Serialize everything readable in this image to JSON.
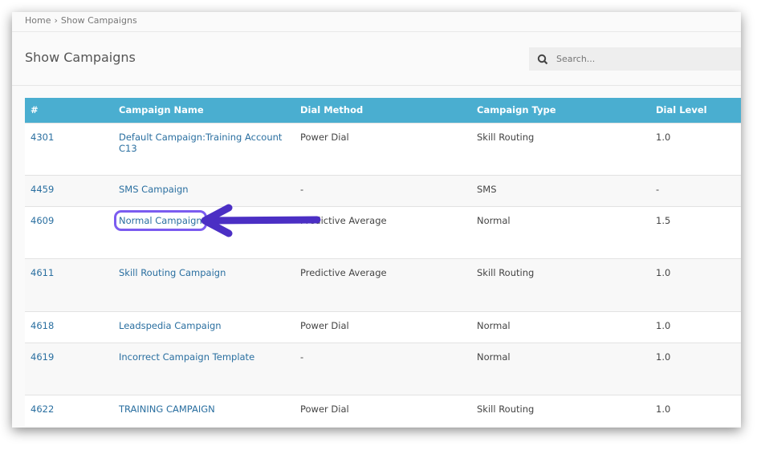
{
  "breadcrumb": {
    "home": "Home",
    "separator": "›",
    "current": "Show Campaigns"
  },
  "page_title": "Show Campaigns",
  "search": {
    "placeholder": "Search...",
    "icon": "search-icon"
  },
  "table": {
    "headers": [
      "#",
      "Campaign Name",
      "Dial Method",
      "Campaign Type",
      "Dial Level"
    ],
    "rows": [
      {
        "id": "4301",
        "name": "Default Campaign:Training Account C13",
        "method": "Power Dial",
        "type": "Skill Routing",
        "level": "1.0",
        "h": 65
      },
      {
        "id": "4459",
        "name": "SMS Campaign",
        "method": "-",
        "type": "SMS",
        "level": "-",
        "h": 39
      },
      {
        "id": "4609",
        "name": "Normal Campaign",
        "method": "Predictive Average",
        "type": "Normal",
        "level": "1.5",
        "h": 65,
        "highlighted": true
      },
      {
        "id": "4611",
        "name": "Skill Routing Campaign",
        "method": "Predictive Average",
        "type": "Skill Routing",
        "level": "1.0",
        "h": 66
      },
      {
        "id": "4618",
        "name": "Leadspedia Campaign",
        "method": "Power Dial",
        "type": "Normal",
        "level": "1.0",
        "h": 39
      },
      {
        "id": "4619",
        "name": "Incorrect Campaign Template",
        "method": "-",
        "type": "Normal",
        "level": "1.0",
        "h": 65
      },
      {
        "id": "4622",
        "name": "TRAINING CAMPAIGN",
        "method": "Power Dial",
        "type": "Skill Routing",
        "level": "1.0",
        "h": 39
      }
    ]
  },
  "annotation": {
    "arrow_color": "#4b2fc4",
    "highlight_color": "#7b5cf0"
  },
  "colors": {
    "header_bg": "#4aaed0",
    "link": "#2a6fa0"
  }
}
